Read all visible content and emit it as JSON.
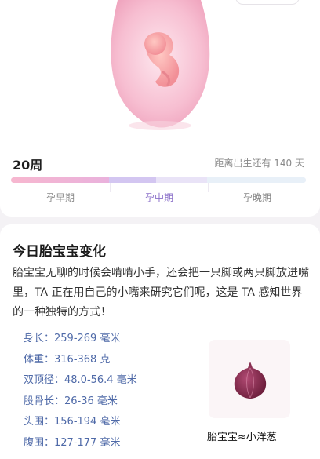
{
  "progress": {
    "week_label": "20周",
    "remaining_text": "距离出生还有 140 天",
    "stages": [
      "孕早期",
      "孕中期",
      "孕晚期"
    ],
    "active_stage_index": 1,
    "week_fraction": 0.5
  },
  "change": {
    "title": "今日胎宝宝变化",
    "description": "胎宝宝无聊的时候会啃啃小手，还会把一只脚或两只脚放进嘴里，TA 正在用自己的小嘴来研究它们呢，这是 TA 感知世界的一种独特的方式！",
    "metrics": [
      "身长：259-269 毫米",
      "体重：316-368 克",
      "双顶径：48.0-56.4 毫米",
      "股骨长：26-36 毫米",
      "头围：156-194 毫米",
      "腹围：127-177 毫米"
    ],
    "fruit_caption": "胎宝宝≈小洋葱"
  },
  "icons": {
    "fetus": "fetus-in-womb-illustration",
    "fruit": "onion-icon"
  },
  "colors": {
    "accent": "#8a6fc9",
    "early_stage": "#f7b7cf",
    "mid_stage": "#d3c6f1",
    "late_stage": "#e8f0f8",
    "metric_text": "#4f6aa8"
  }
}
